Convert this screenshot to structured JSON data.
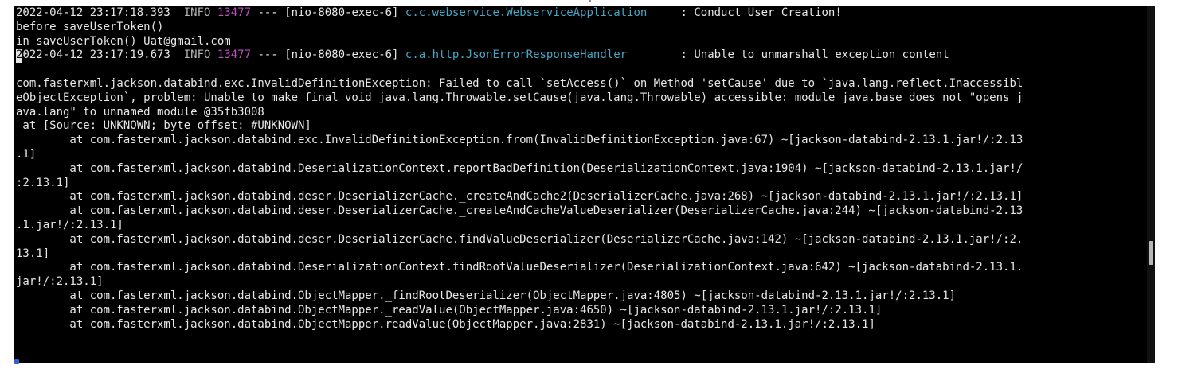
{
  "terminal": {
    "lines": [
      {
        "segments": [
          {
            "text": "2022-04-12 23:17:18.393  ",
            "style": "ts"
          },
          {
            "text": "INFO ",
            "style": "lvl"
          },
          {
            "text": "13477",
            "style": "pid"
          },
          {
            "text": " --- [nio-8080-exec-6] ",
            "style": "ts"
          },
          {
            "text": "c.c.webservice.WebserviceApplication",
            "style": "cls"
          },
          {
            "text": "     : Conduct User Creation!",
            "style": "ts"
          }
        ]
      },
      {
        "segments": [
          {
            "text": "before saveUserToken()",
            "style": "ts"
          }
        ]
      },
      {
        "segments": [
          {
            "text": "in saveUserToken() Uat@gmail.com",
            "style": "ts"
          }
        ]
      },
      {
        "segments": [
          {
            "text": "2",
            "style": "cursor"
          },
          {
            "text": "022-04-12 23:17:19.673  ",
            "style": "ts"
          },
          {
            "text": "INFO ",
            "style": "lvl"
          },
          {
            "text": "13477",
            "style": "pid"
          },
          {
            "text": " --- [nio-8080-exec-6] ",
            "style": "ts"
          },
          {
            "text": "c.a.http.JsonErrorResponseHandler",
            "style": "cls"
          },
          {
            "text": "        : Unable to unmarshall exception content",
            "style": "ts"
          }
        ]
      },
      {
        "segments": [
          {
            "text": "",
            "style": "ts"
          }
        ]
      },
      {
        "segments": [
          {
            "text": "com.fasterxml.jackson.databind.exc.InvalidDefinitionException: Failed to call `setAccess()` on Method 'setCause' due to `java.lang.reflect.Inaccessibl",
            "style": "ts"
          }
        ]
      },
      {
        "segments": [
          {
            "text": "eObjectException`, problem: Unable to make final void java.lang.Throwable.setCause(java.lang.Throwable) accessible: module java.base does not \"opens j",
            "style": "ts"
          }
        ]
      },
      {
        "segments": [
          {
            "text": "ava.lang\" to unnamed module @35fb3008",
            "style": "ts"
          }
        ]
      },
      {
        "segments": [
          {
            "text": " at [Source: UNKNOWN; byte offset: #UNKNOWN]",
            "style": "ts"
          }
        ]
      },
      {
        "segments": [
          {
            "text": "        at com.fasterxml.jackson.databind.exc.InvalidDefinitionException.from(InvalidDefinitionException.java:67) ~[jackson-databind-2.13.1.jar!/:2.13",
            "style": "ts"
          }
        ]
      },
      {
        "segments": [
          {
            "text": ".1]",
            "style": "ts"
          }
        ]
      },
      {
        "segments": [
          {
            "text": "        at com.fasterxml.jackson.databind.DeserializationContext.reportBadDefinition(DeserializationContext.java:1904) ~[jackson-databind-2.13.1.jar!/",
            "style": "ts"
          }
        ]
      },
      {
        "segments": [
          {
            "text": ":2.13.1]",
            "style": "ts"
          }
        ]
      },
      {
        "segments": [
          {
            "text": "        at com.fasterxml.jackson.databind.deser.DeserializerCache._createAndCache2(DeserializerCache.java:268) ~[jackson-databind-2.13.1.jar!/:2.13.1]",
            "style": "ts"
          }
        ]
      },
      {
        "segments": [
          {
            "text": "        at com.fasterxml.jackson.databind.deser.DeserializerCache._createAndCacheValueDeserializer(DeserializerCache.java:244) ~[jackson-databind-2.13",
            "style": "ts"
          }
        ]
      },
      {
        "segments": [
          {
            "text": ".1.jar!/:2.13.1]",
            "style": "ts"
          }
        ]
      },
      {
        "segments": [
          {
            "text": "        at com.fasterxml.jackson.databind.deser.DeserializerCache.findValueDeserializer(DeserializerCache.java:142) ~[jackson-databind-2.13.1.jar!/:2.",
            "style": "ts"
          }
        ]
      },
      {
        "segments": [
          {
            "text": "13.1]",
            "style": "ts"
          }
        ]
      },
      {
        "segments": [
          {
            "text": "        at com.fasterxml.jackson.databind.DeserializationContext.findRootValueDeserializer(DeserializationContext.java:642) ~[jackson-databind-2.13.1.",
            "style": "ts"
          }
        ]
      },
      {
        "segments": [
          {
            "text": "jar!/:2.13.1]",
            "style": "ts"
          }
        ]
      },
      {
        "segments": [
          {
            "text": "        at com.fasterxml.jackson.databind.ObjectMapper._findRootDeserializer(ObjectMapper.java:4805) ~[jackson-databind-2.13.1.jar!/:2.13.1]",
            "style": "ts"
          }
        ]
      },
      {
        "segments": [
          {
            "text": "        at com.fasterxml.jackson.databind.ObjectMapper._readValue(ObjectMapper.java:4650) ~[jackson-databind-2.13.1.jar!/:2.13.1]",
            "style": "ts"
          }
        ]
      },
      {
        "segments": [
          {
            "text": "        at com.fasterxml.jackson.databind.ObjectMapper.readValue(ObjectMapper.java:2831) ~[jackson-databind-2.13.1.jar!/:2.13.1]",
            "style": "ts"
          }
        ]
      }
    ]
  },
  "colors": {
    "background": "#000000",
    "text": "#e6e6e6",
    "level": "#b3b3b3",
    "pid": "#c04ec0",
    "logger": "#46a6c4"
  }
}
